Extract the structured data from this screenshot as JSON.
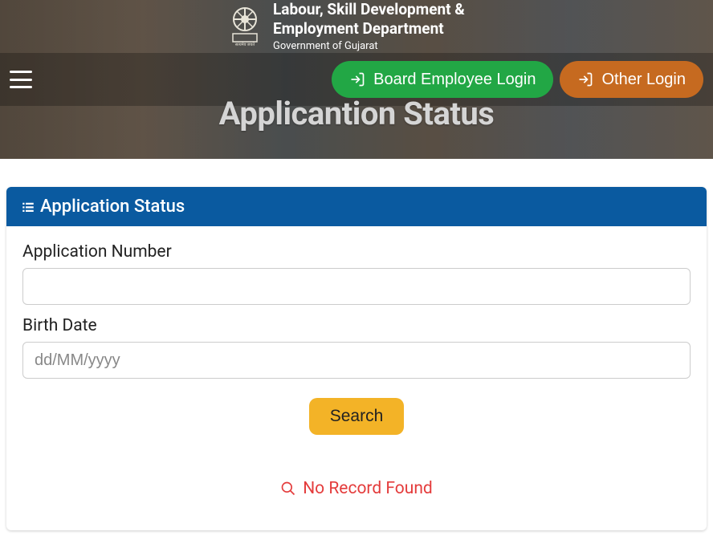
{
  "header": {
    "dept_line1": "Labour, Skill Development &",
    "dept_line2": "Employment Department",
    "dept_sub": "Government of Gujarat"
  },
  "nav": {
    "board_login": "Board Employee Login",
    "other_login": "Other Login"
  },
  "page_title": "Applicantion Status",
  "card": {
    "header": "Application Status",
    "app_num_label": "Application Number",
    "app_num_value": "",
    "birth_label": "Birth Date",
    "birth_placeholder": "dd/MM/yyyy",
    "birth_value": "",
    "search_label": "Search",
    "status_msg": "No Record Found"
  }
}
